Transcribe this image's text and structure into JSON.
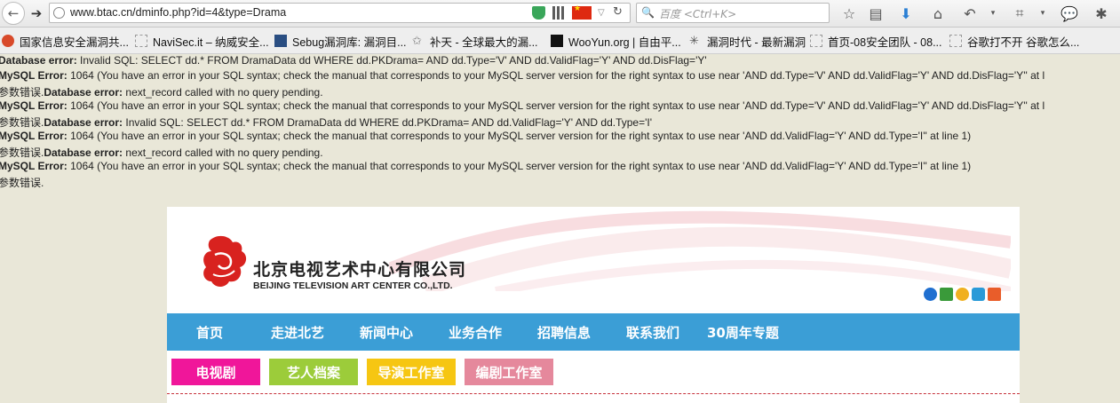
{
  "browser": {
    "url": "www.btac.cn/dminfo.php?id=4&type=Drama",
    "search_engine": "百度",
    "search_placeholder": "<Ctrl+K>",
    "bookmarks": [
      {
        "label": "国家信息安全漏洞共..."
      },
      {
        "label": "NaviSec.it – 纳威安全..."
      },
      {
        "label": "Sebug漏洞库: 漏洞目..."
      },
      {
        "label": "补天 - 全球最大的漏..."
      },
      {
        "label": "WooYun.org | 自由平..."
      },
      {
        "label": "漏洞时代 - 最新漏洞"
      },
      {
        "label": "首页-08安全团队 - 08..."
      },
      {
        "label": "谷歌打不开 谷歌怎么..."
      }
    ]
  },
  "errors": [
    {
      "prefix": "",
      "label": "Database error:",
      "text": " Invalid SQL: SELECT dd.* FROM DramaData dd WHERE dd.PKDrama= AND dd.Type='V' AND dd.ValidFlag='Y' AND dd.DisFlag='Y'"
    },
    {
      "prefix": "",
      "label": "MySQL Error:",
      "text": " 1064 (You have an error in your SQL syntax; check the manual that corresponds to your MySQL server version for the right syntax to use near 'AND dd.Type='V' AND dd.ValidFlag='Y' AND dd.DisFlag='Y'' at l"
    },
    {
      "prefix": "参数错误.",
      "label": "Database error:",
      "text": " next_record called with no query pending."
    },
    {
      "prefix": "",
      "label": "MySQL Error:",
      "text": " 1064 (You have an error in your SQL syntax; check the manual that corresponds to your MySQL server version for the right syntax to use near 'AND dd.Type='V' AND dd.ValidFlag='Y' AND dd.DisFlag='Y'' at l"
    },
    {
      "prefix": "参数错误.",
      "label": "Database error:",
      "text": " Invalid SQL: SELECT dd.* FROM DramaData dd WHERE dd.PKDrama= AND dd.ValidFlag='Y' AND dd.Type='I'"
    },
    {
      "prefix": "",
      "label": "MySQL Error:",
      "text": " 1064 (You have an error in your SQL syntax; check the manual that corresponds to your MySQL server version for the right syntax to use near 'AND dd.ValidFlag='Y' AND dd.Type='I'' at line 1)"
    },
    {
      "prefix": "参数错误.",
      "label": "Database error:",
      "text": " next_record called with no query pending."
    },
    {
      "prefix": "",
      "label": "MySQL Error:",
      "text": " 1064 (You have an error in your SQL syntax; check the manual that corresponds to your MySQL server version for the right syntax to use near 'AND dd.ValidFlag='Y' AND dd.Type='I'' at line 1)"
    },
    {
      "prefix": "参数错误.",
      "label": "",
      "text": ""
    }
  ],
  "site": {
    "logo_cn": "北京电视艺术中心有限公司",
    "logo_en": "BEIJING TELEVISION ART CENTER CO.,LTD.",
    "nav": [
      "首页",
      "走进北艺",
      "新闻中心",
      "业务合作",
      "招聘信息",
      "联系我们",
      "30周年专题"
    ],
    "tabs": [
      "电视剧",
      "艺人档案",
      "导演工作室",
      "编剧工作室"
    ],
    "colors": {
      "nav_bg": "#3b9ed6",
      "tab1": "#f0169a",
      "tab2": "#9ccc3a",
      "tab3": "#f6c612",
      "tab4": "#e5889c",
      "logo_red": "#d8221f"
    }
  }
}
